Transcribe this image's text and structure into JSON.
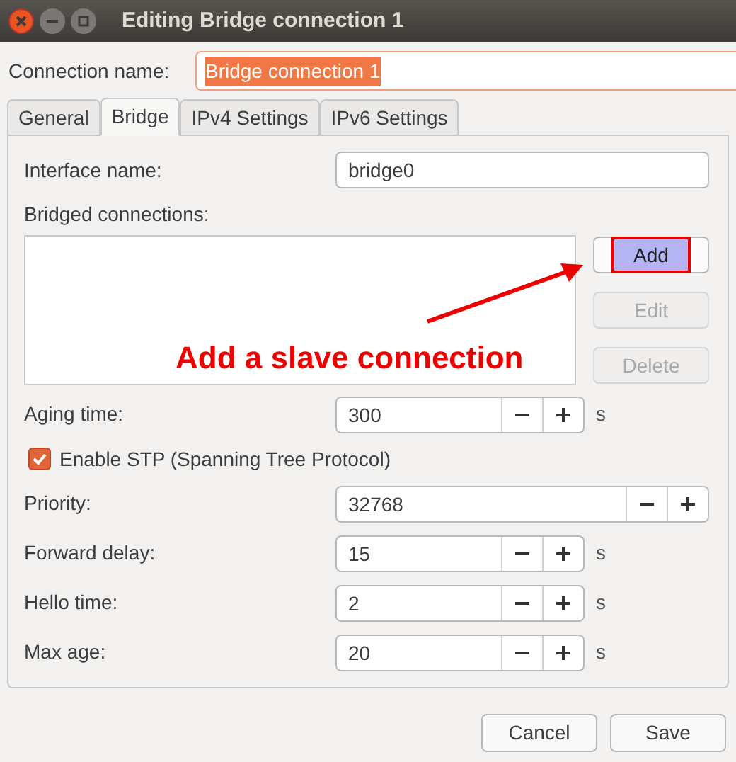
{
  "window": {
    "title": "Editing Bridge connection 1"
  },
  "connection_name": {
    "label": "Connection name:",
    "value": "Bridge connection 1",
    "text_selected": true
  },
  "tabs": [
    {
      "label": "General",
      "selected": false
    },
    {
      "label": "Bridge",
      "selected": true
    },
    {
      "label": "IPv4 Settings",
      "selected": false
    },
    {
      "label": "IPv6 Settings",
      "selected": false
    }
  ],
  "interface_name": {
    "label": "Interface name:",
    "value": "bridge0"
  },
  "bridged_connections": {
    "label": "Bridged connections:",
    "buttons": [
      {
        "label": "Add",
        "disabled": false,
        "highlighted": true
      },
      {
        "label": "Edit",
        "disabled": true,
        "highlighted": false
      },
      {
        "label": "Delete",
        "disabled": true,
        "highlighted": false
      }
    ]
  },
  "settings": [
    {
      "kind": "spin",
      "label": "Aging time:",
      "value": "300",
      "unit": "s"
    },
    {
      "kind": "checkbox",
      "label": "Enable STP (Spanning Tree Protocol)",
      "checked": true
    },
    {
      "kind": "spin",
      "label": "Priority:",
      "value": "32768"
    },
    {
      "kind": "spin",
      "label": "Forward delay:",
      "value": "15",
      "unit": "s"
    },
    {
      "kind": "spin",
      "label": "Hello time:",
      "value": "2",
      "unit": "s"
    },
    {
      "kind": "spin",
      "label": "Max age:",
      "value": "20",
      "unit": "s"
    }
  ],
  "annotation": {
    "text": "Add a slave connection"
  },
  "buttons": [
    {
      "label": "Cancel"
    },
    {
      "label": "Save"
    }
  ]
}
